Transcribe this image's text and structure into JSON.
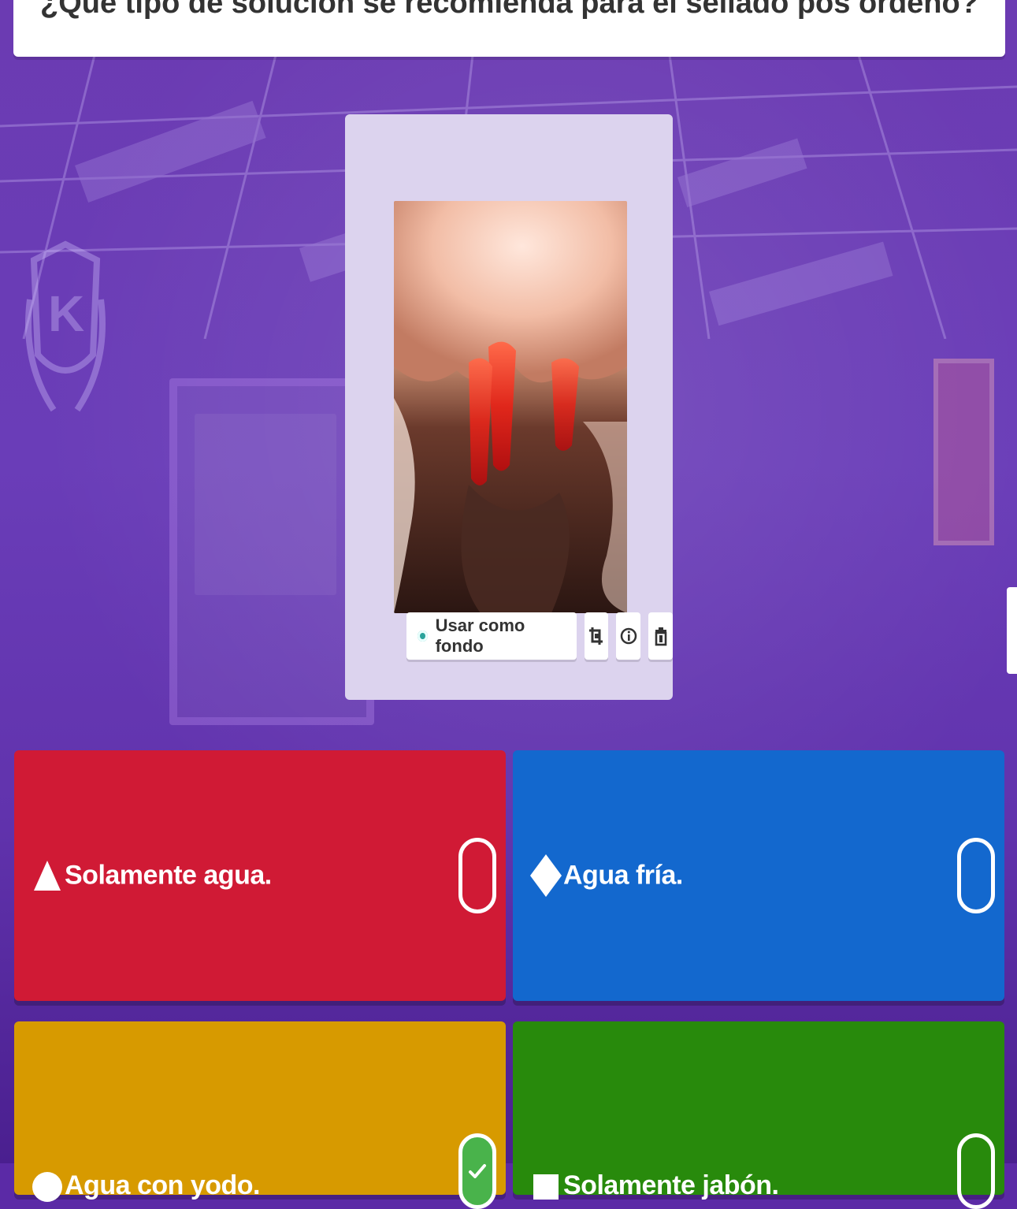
{
  "question": {
    "text": "¿Qué tipo de solución se recomienda para el sellado pos ordeño?"
  },
  "media": {
    "use_as_background_label": "Usar como fondo",
    "tools": [
      {
        "name": "crop-icon"
      },
      {
        "name": "info-icon"
      },
      {
        "name": "trash-icon"
      }
    ]
  },
  "answers": [
    {
      "text": "Solamente agua.",
      "shape": "triangle-icon",
      "color": "#d01a35",
      "correct": false
    },
    {
      "text": "Agua  fría.",
      "shape": "diamond-icon",
      "color": "#1368ce",
      "correct": false
    },
    {
      "text": "Agua con yodo.",
      "shape": "circle-icon",
      "color": "#d79a00",
      "correct": true
    },
    {
      "text": "Solamente jabón.",
      "shape": "square-icon",
      "color": "#288a0c",
      "correct": false
    }
  ],
  "colors": {
    "background_purple": "#6b3bb2",
    "media_card": "#dcd3ee"
  }
}
